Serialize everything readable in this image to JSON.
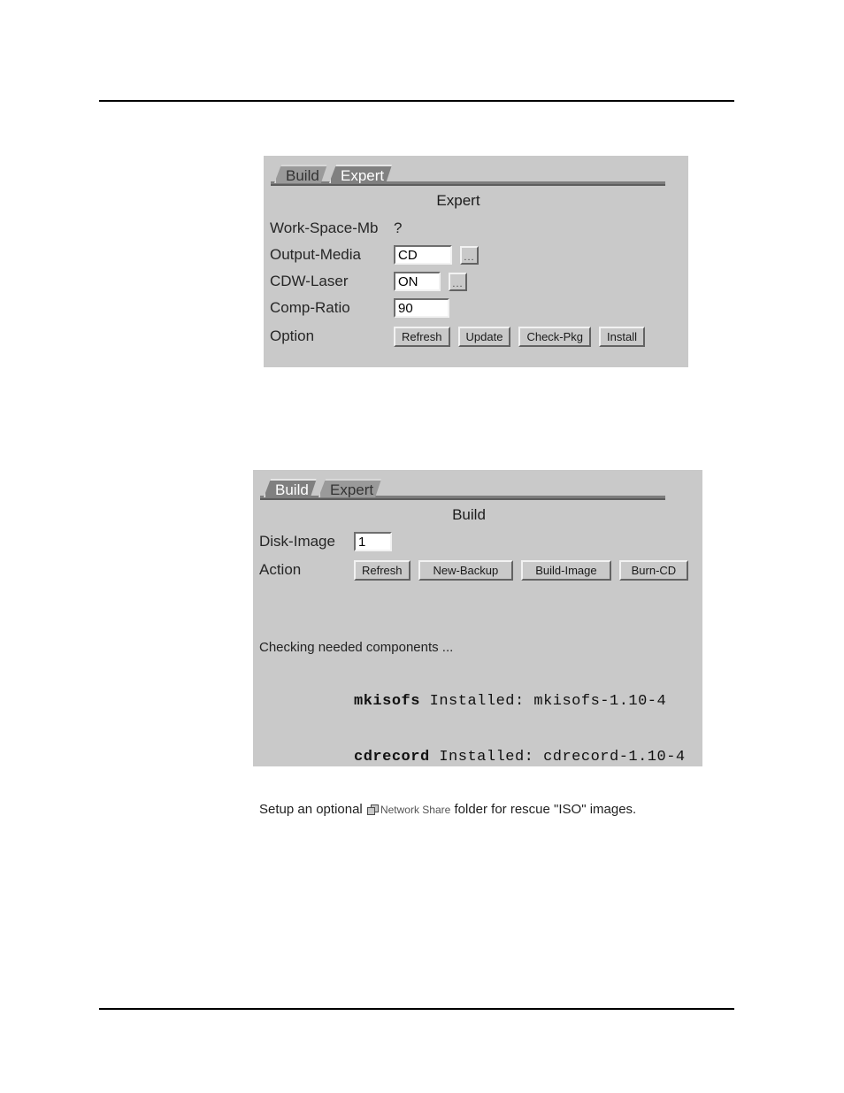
{
  "document": {
    "header_rule": true,
    "footer_rule": true,
    "background": "#ffffff"
  },
  "theme": {
    "panel_bg": "#c9c9c9",
    "tab_selected_bg": "#808080",
    "tab_unselected_bg": "#9a9a9a",
    "tab_selected_fg": "#ffffff",
    "tab_unselected_fg": "#333333",
    "entry_bg": "#ffffff"
  },
  "expert_panel": {
    "tabs": [
      {
        "label": "Build",
        "selected": false
      },
      {
        "label": "Expert",
        "selected": true
      }
    ],
    "heading": "Expert",
    "rows": [
      {
        "label": "Work-Space-Mb",
        "kind": "text",
        "value": "?"
      },
      {
        "label": "Output-Media",
        "kind": "entry",
        "value": "CD",
        "browse_label": "..."
      },
      {
        "label": "CDW-Laser",
        "kind": "entry",
        "value": "ON",
        "browse_label": "..."
      },
      {
        "label": "Comp-Ratio",
        "kind": "entry",
        "value": "90"
      },
      {
        "label": "Option",
        "kind": "buttons",
        "buttons": [
          "Refresh",
          "Update",
          "Check-Pkg",
          "Install"
        ]
      }
    ]
  },
  "build_panel": {
    "tabs": [
      {
        "label": "Build",
        "selected": true
      },
      {
        "label": "Expert",
        "selected": false
      }
    ],
    "heading": "Build",
    "disk_image_label": "Disk-Image",
    "disk_image_value": "1",
    "action_label": "Action",
    "action_buttons": [
      "Refresh",
      "New-Backup",
      "Build-Image",
      "Burn-CD"
    ],
    "status_line": "Checking needed components ...",
    "console": [
      {
        "name": "mkisofs",
        "text": " Installed: mkisofs-1.10-4"
      },
      {
        "name": "cdrecord",
        "text": " Installed: cdrecord-1.10-4"
      }
    ],
    "footer": {
      "prefix": "Setup an optional ",
      "link_icon": "network-share-icon",
      "link_label": "Network Share",
      "suffix": " folder for rescue \"ISO\" images."
    }
  }
}
